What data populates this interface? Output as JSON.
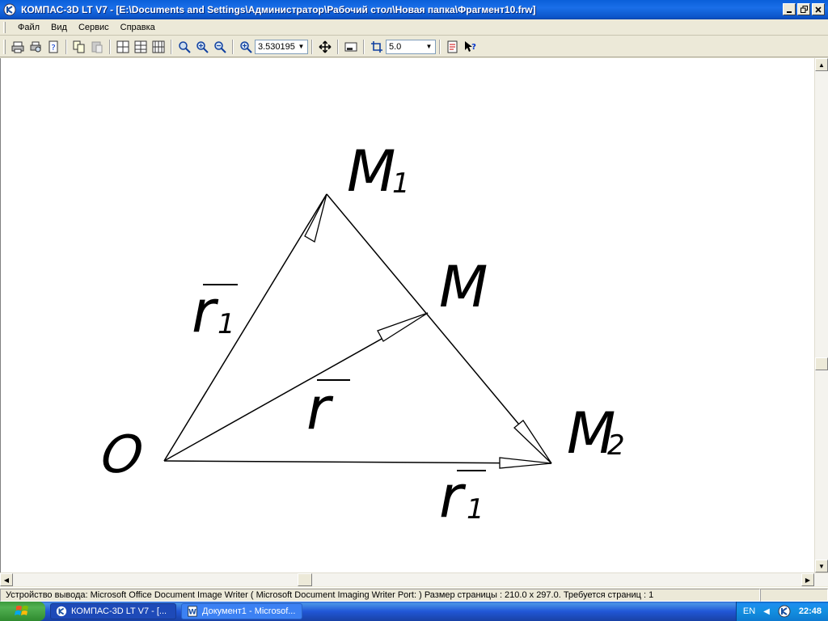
{
  "window": {
    "title": "КОМПАС-3D LT V7 - [E:\\Documents and Settings\\Администратор\\Рабочий стол\\Новая папка\\Фрагмент10.frw]"
  },
  "menu": {
    "items": [
      {
        "label": "Файл"
      },
      {
        "label": "Вид"
      },
      {
        "label": "Сервис"
      },
      {
        "label": "Справка"
      }
    ]
  },
  "toolbar": {
    "zoom_value": "3.530195",
    "step_value": "5.0"
  },
  "drawing": {
    "point_o": "O",
    "point_m1": "M",
    "point_m1_sub": "1",
    "point_m": "M",
    "point_m2": "M",
    "point_m2_sub": "2",
    "vec_r1": "r",
    "vec_r1_sub": "1",
    "vec_r": "r",
    "vec_r1b": "r",
    "vec_r1b_sub": "1"
  },
  "statusbar": {
    "text": "Устройство вывода: Microsoft Office Document Image Writer ( Microsoft Document Imaging Writer Port: )  Размер страницы : 210.0 x 297.0.  Требуется страниц : 1"
  },
  "taskbar": {
    "tasks": [
      {
        "label": "КОМПАС-3D LT V7 - [..."
      },
      {
        "label": "Документ1 - Microsof..."
      }
    ],
    "lang": "EN",
    "time": "22:48"
  }
}
